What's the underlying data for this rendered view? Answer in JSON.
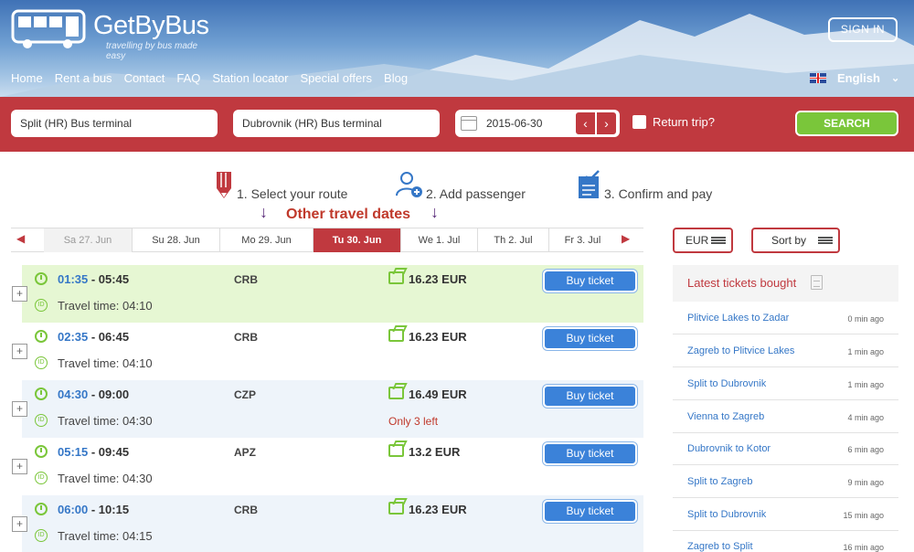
{
  "brand": {
    "name": "GetByBus",
    "tagline": "travelling by bus made easy"
  },
  "header": {
    "signin_label": "SIGN IN",
    "nav": [
      "Home",
      "Rent a bus",
      "Contact",
      "FAQ",
      "Station locator",
      "Special offers",
      "Blog"
    ],
    "language": "English"
  },
  "search": {
    "from": "Split (HR) Bus terminal",
    "to": "Dubrovnik (HR) Bus terminal",
    "date": "2015-06-30",
    "return_label": "Return trip?",
    "button": "SEARCH"
  },
  "steps": {
    "s1": "1. Select your route",
    "s2": "2. Add passenger",
    "s3": "3. Confirm and pay",
    "hint": "Other travel dates"
  },
  "dates": [
    "Sa 27. Jun",
    "Su 28. Jun",
    "Mo 29. Jun",
    "Tu 30. Jun",
    "We 1. Jul",
    "Th 2. Jul",
    "Fr 3. Jul"
  ],
  "results": [
    {
      "dep": "01:35",
      "arr": " - 05:45",
      "travel": "Travel time: 04:10",
      "carrier": "CRB",
      "price": "16.23 EUR",
      "note": "",
      "buy": "Buy ticket"
    },
    {
      "dep": "02:35",
      "arr": " - 06:45",
      "travel": "Travel time: 04:10",
      "carrier": "CRB",
      "price": "16.23 EUR",
      "note": "",
      "buy": "Buy ticket"
    },
    {
      "dep": "04:30",
      "arr": " - 09:00",
      "travel": "Travel time: 04:30",
      "carrier": "CZP",
      "price": "16.49 EUR",
      "note": "Only 3 left",
      "buy": "Buy ticket"
    },
    {
      "dep": "05:15",
      "arr": " - 09:45",
      "travel": "Travel time: 04:30",
      "carrier": "APZ",
      "price": "13.2 EUR",
      "note": "",
      "buy": "Buy ticket"
    },
    {
      "dep": "06:00",
      "arr": " - 10:15",
      "travel": "Travel time: 04:15",
      "carrier": "CRB",
      "price": "16.23 EUR",
      "note": "",
      "buy": "Buy ticket"
    }
  ],
  "sidebar": {
    "currency": "EUR",
    "sort": "Sort by",
    "latest_title": "Latest tickets bought",
    "trips": [
      {
        "route": "Plitvice Lakes to Zadar",
        "ago": "0 min ago"
      },
      {
        "route": "Zagreb to Plitvice Lakes",
        "ago": "1 min ago"
      },
      {
        "route": "Split to Dubrovnik",
        "ago": "1 min ago"
      },
      {
        "route": "Vienna to Zagreb",
        "ago": "4 min ago"
      },
      {
        "route": "Dubrovnik to Kotor",
        "ago": "6 min ago"
      },
      {
        "route": "Split to Zagreb",
        "ago": "9 min ago"
      },
      {
        "route": "Split to Dubrovnik",
        "ago": "15 min ago"
      },
      {
        "route": "Zagreb to Split",
        "ago": "16 min ago"
      }
    ]
  },
  "colors": {
    "brand_red": "#c0393f",
    "accent_green": "#7ac63a",
    "link_blue": "#3577c7",
    "button_blue": "#3b82d9"
  }
}
